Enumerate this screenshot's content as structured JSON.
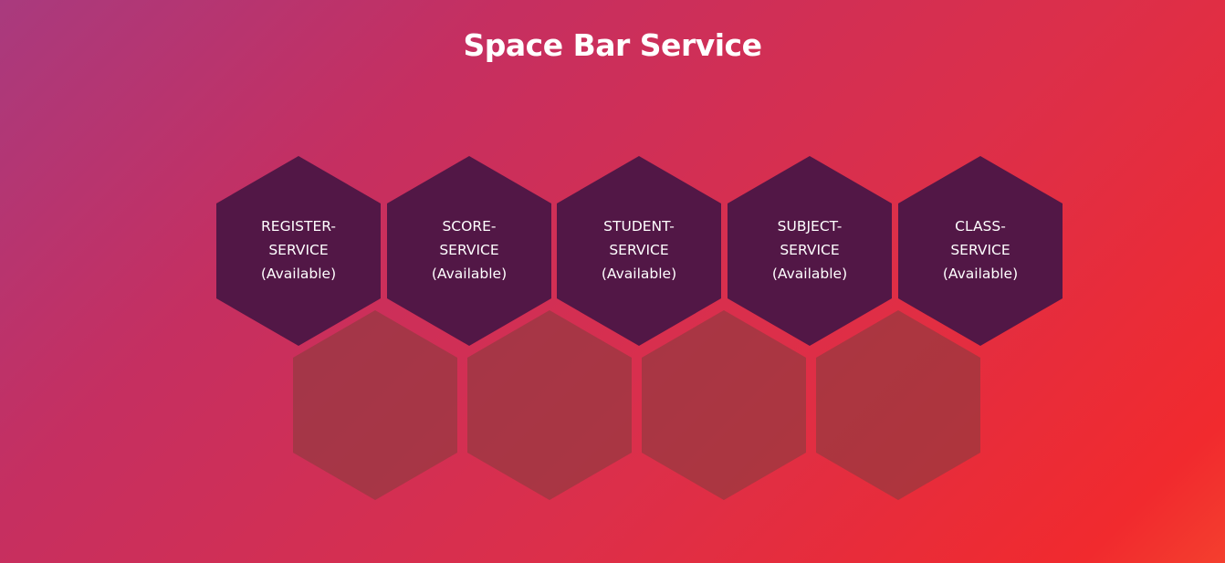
{
  "header": {
    "title": "Space Bar Service"
  },
  "services": [
    {
      "line1": "REGISTER-",
      "line2": "SERVICE",
      "status": "(Available)"
    },
    {
      "line1": "SCORE-",
      "line2": "SERVICE",
      "status": "(Available)"
    },
    {
      "line1": "STUDENT-",
      "line2": "SERVICE",
      "status": "(Available)"
    },
    {
      "line1": "SUBJECT-",
      "line2": "SERVICE",
      "status": "(Available)"
    },
    {
      "line1": "CLASS-",
      "line2": "SERVICE",
      "status": "(Available)"
    }
  ],
  "colors": {
    "tile": "#521746",
    "placeholder_tile": "#8f3a3f",
    "text": "#ffffff"
  }
}
